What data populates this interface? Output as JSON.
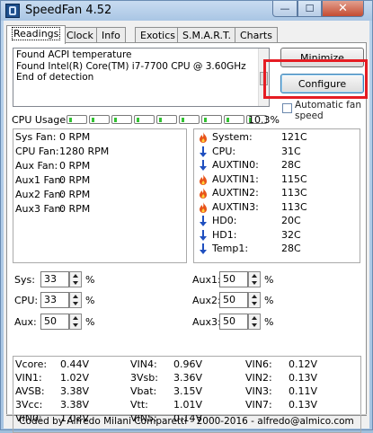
{
  "window": {
    "title": "SpeedFan 4.52"
  },
  "tabs": [
    {
      "label": "Readings",
      "active": true
    },
    {
      "label": "Clock"
    },
    {
      "label": "Info"
    },
    {
      "label": "Exotics"
    },
    {
      "label": "S.M.A.R.T."
    },
    {
      "label": "Charts"
    }
  ],
  "log": {
    "lines": [
      "Found ACPI temperature",
      "Found Intel(R) Core(TM) i7-7700 CPU @ 3.60GHz",
      "End of detection"
    ]
  },
  "buttons": {
    "minimize": "Minimize",
    "configure": "Configure"
  },
  "auto_fan_speed": {
    "label": "Automatic fan speed",
    "checked": false
  },
  "cpu_usage": {
    "label": "CPU Usage",
    "percent": "10.3%",
    "segments": 9
  },
  "fans": [
    {
      "label": "Sys Fan:",
      "value": "0 RPM"
    },
    {
      "label": "CPU Fan:",
      "value": "1280 RPM"
    },
    {
      "label": "Aux Fan:",
      "value": "0 RPM"
    },
    {
      "label": "Aux1 Fan:",
      "value": "0 RPM"
    },
    {
      "label": "Aux2 Fan:",
      "value": "0 RPM"
    },
    {
      "label": "Aux3 Fan:",
      "value": "0 RPM"
    }
  ],
  "temps": [
    {
      "label": "System:",
      "value": "121C",
      "status": "flame"
    },
    {
      "label": "CPU:",
      "value": "31C",
      "status": "down"
    },
    {
      "label": "AUXTIN0:",
      "value": "28C",
      "status": "down"
    },
    {
      "label": "AUXTIN1:",
      "value": "115C",
      "status": "flame"
    },
    {
      "label": "AUXTIN2:",
      "value": "113C",
      "status": "flame"
    },
    {
      "label": "AUXTIN3:",
      "value": "113C",
      "status": "flame"
    },
    {
      "label": "HD0:",
      "value": "20C",
      "status": "down"
    },
    {
      "label": "HD1:",
      "value": "32C",
      "status": "down"
    },
    {
      "label": "Temp1:",
      "value": "28C",
      "status": "down"
    }
  ],
  "speeds": [
    {
      "label": "Sys:",
      "value": "33"
    },
    {
      "label": "CPU:",
      "value": "33"
    },
    {
      "label": "Aux:",
      "value": "50"
    },
    {
      "label": "Aux1:",
      "value": "50"
    },
    {
      "label": "Aux2:",
      "value": "50"
    },
    {
      "label": "Aux3:",
      "value": "50"
    }
  ],
  "percent_sign": "%",
  "voltages": [
    [
      {
        "label": "Vcore:",
        "value": "0.44V"
      },
      {
        "label": "VIN1:",
        "value": "1.02V"
      },
      {
        "label": "AVSB:",
        "value": "3.38V"
      },
      {
        "label": "3Vcc:",
        "value": "3.38V"
      },
      {
        "label": "VIN0:",
        "value": "1.02V"
      }
    ],
    [
      {
        "label": "VIN4:",
        "value": "0.96V"
      },
      {
        "label": "3Vsb:",
        "value": "3.36V"
      },
      {
        "label": "Vbat:",
        "value": "3.15V"
      },
      {
        "label": "Vtt:",
        "value": "1.01V"
      },
      {
        "label": "VIN5:",
        "value": "0.14V"
      }
    ],
    [
      {
        "label": "VIN6:",
        "value": "0.12V"
      },
      {
        "label": "VIN2:",
        "value": "0.13V"
      },
      {
        "label": "VIN3:",
        "value": "0.11V"
      },
      {
        "label": "VIN7:",
        "value": "0.13V"
      }
    ]
  ],
  "status_bar": "Coded by Alfredo Milani Comparetti - 2000-2016 - alfredo@almico.com",
  "colors": {
    "highlight": "#e51c23",
    "cpu_bar_fill": "#33c233",
    "flame": "#e8541a",
    "arrow": "#1f4fbf"
  }
}
